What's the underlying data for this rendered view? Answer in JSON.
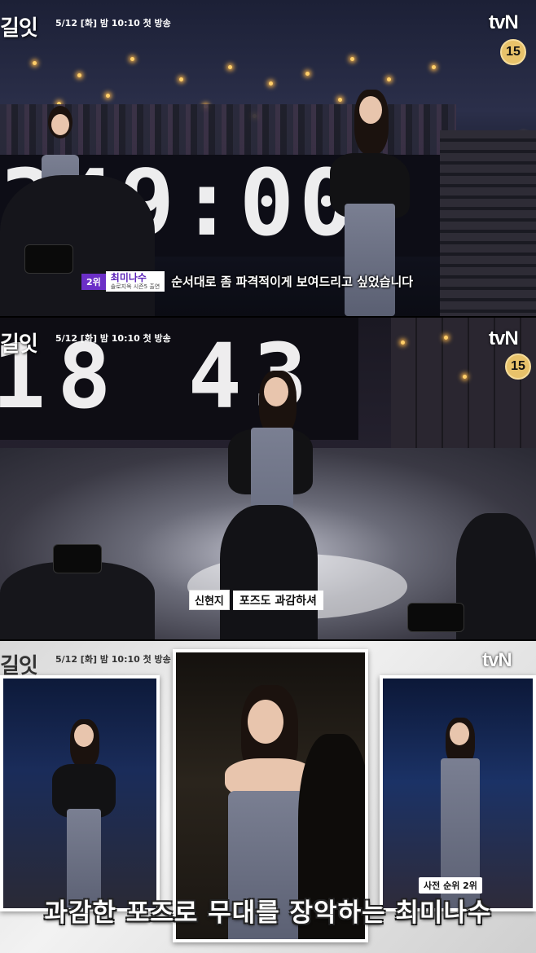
{
  "show": {
    "logo_text": "길잇",
    "air_info": "5/12 [화] 밤 10:10 첫 방송",
    "channel": "tvN",
    "rating": "15"
  },
  "panel1": {
    "clock_text": "49:00",
    "clock_left_partial": "3",
    "name_tag": {
      "rank": "2위",
      "name": "최미나수",
      "sub": "솔로지옥 시즌5 출연"
    },
    "subtitle": "순서대로 좀 파격적이게 보여드리고 싶었습니다"
  },
  "panel2": {
    "clock_text": "18 43",
    "name_tag": {
      "name": "신현지",
      "subtitle": "포즈도 과감하셔"
    }
  },
  "panel3": {
    "right_card_badge": "사전 순위 2위",
    "caption": "과감한 포즈로 무대를 장악하는 최미나수"
  },
  "colors": {
    "accent_purple": "#6b2fc7",
    "rating_gold": "#e8c26a"
  }
}
